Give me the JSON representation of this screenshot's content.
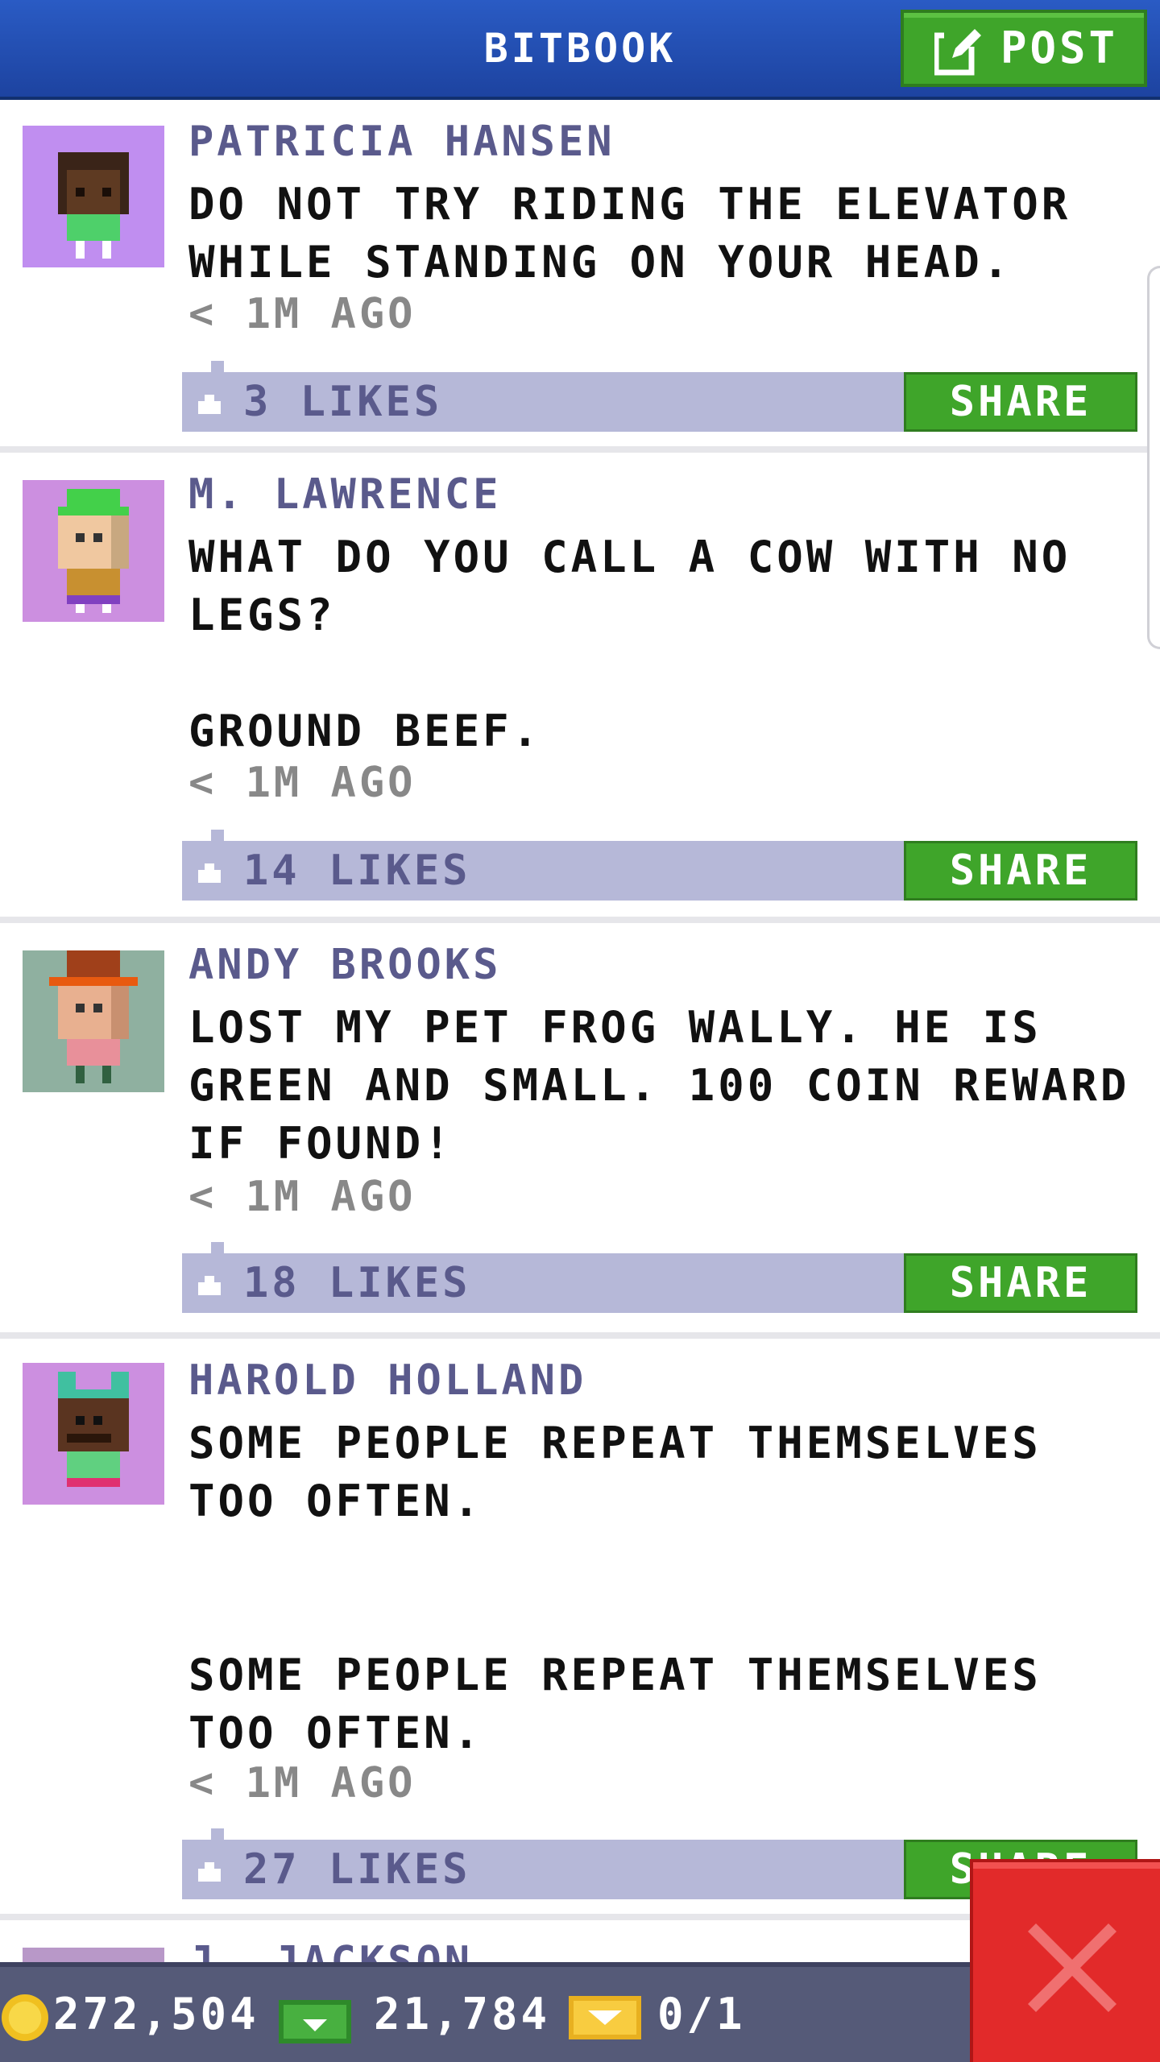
{
  "header": {
    "title": "BITBOOK",
    "post_label": "POST"
  },
  "posts": [
    {
      "author": "PATRICIA HANSEN",
      "message": "DO NOT TRY RIDING THE ELEVATOR WHILE STANDING ON YOUR HEAD.",
      "time": "< 1M AGO",
      "likes": "3 LIKES",
      "share": "SHARE",
      "avatar_bg": "#c08ef0"
    },
    {
      "author": "M. LAWRENCE",
      "message": "WHAT DO YOU CALL A COW WITH NO LEGS?\n\nGROUND BEEF.",
      "time": "< 1M AGO",
      "likes": "14 LIKES",
      "share": "SHARE",
      "avatar_bg": "#cc8fe0"
    },
    {
      "author": "ANDY BROOKS",
      "message": "LOST MY PET FROG WALLY. HE IS GREEN AND SMALL. 100 COIN REWARD IF FOUND!",
      "time": "< 1M AGO",
      "likes": "18 LIKES",
      "share": "SHARE",
      "avatar_bg": "#8fb0a0"
    },
    {
      "author": "HAROLD HOLLAND",
      "message": "SOME PEOPLE REPEAT THEMSELVES TOO OFTEN.\n\n\nSOME PEOPLE REPEAT THEMSELVES TOO OFTEN.",
      "time": "< 1M AGO",
      "likes": "27 LIKES",
      "share": "SHARE",
      "avatar_bg": "#cc8fe0"
    },
    {
      "author": "J. JACKSON"
    }
  ],
  "footer": {
    "coins": "272,504",
    "bux": "21,784",
    "tickets": "0/1"
  },
  "icons": {
    "post": "compose-icon",
    "like": "thumbs-up-icon",
    "coin": "coin-icon",
    "bux": "bux-icon",
    "ticket": "ticket-icon",
    "close": "close-icon"
  },
  "colors": {
    "header": "#2a5bc4",
    "accent_green": "#3fa52a",
    "like_bar": "#b6b8d8",
    "name": "#5a5a8c",
    "close": "#e22a2a",
    "footer": "#555a78"
  }
}
